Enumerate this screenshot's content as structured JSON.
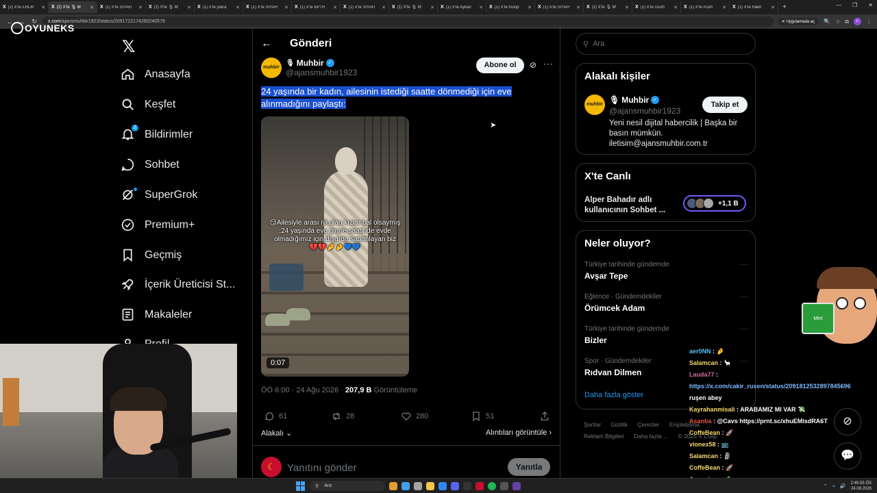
{
  "browser": {
    "tabs": [
      {
        "label": "(2) X'te ERLIK",
        "active": false
      },
      {
        "label": "(2) X'te 🎙 M",
        "active": true
      },
      {
        "label": "(1) X'te SİYAH",
        "active": false
      },
      {
        "label": "(2) X'te 🎙 M",
        "active": false
      },
      {
        "label": "(1) X'te yalca",
        "active": false
      },
      {
        "label": "(1) X'te SİYAH",
        "active": false
      },
      {
        "label": "(1) X'te BPTH",
        "active": false
      },
      {
        "label": "(1) X'te SİYAH",
        "active": false
      },
      {
        "label": "(1) X'te 🎙 M",
        "active": false
      },
      {
        "label": "(1) X'te Aykan",
        "active": false
      },
      {
        "label": "(1) X'te moop",
        "active": false
      },
      {
        "label": "(1) X'te SİYAH",
        "active": false
      },
      {
        "label": "(1) X'te 🎙 M",
        "active": false
      },
      {
        "label": "(1) X'te Gush",
        "active": false
      },
      {
        "label": "(1) X'te Push",
        "active": false
      },
      {
        "label": "(1) X'te Hakh",
        "active": false
      }
    ],
    "url": "x.com/ajansmuhbir1923/status/2091722174260240579",
    "url_domain": "x.com",
    "url_path": "/ajansmuhbir1923/status/2091722174260240579",
    "app_button": "Uygulamada aç"
  },
  "overlay_logo": "OYUNEKS",
  "nav": {
    "items": [
      {
        "label": "Anasayfa",
        "icon": "home-icon"
      },
      {
        "label": "Keşfet",
        "icon": "search-icon"
      },
      {
        "label": "Bildirimler",
        "icon": "bell-icon",
        "badge": "2"
      },
      {
        "label": "Sohbet",
        "icon": "chat-icon"
      },
      {
        "label": "SuperGrok",
        "icon": "grok-icon"
      },
      {
        "label": "Premium+",
        "icon": "verified-icon"
      },
      {
        "label": "Geçmiş",
        "icon": "bookmark-icon"
      },
      {
        "label": "İçerik Üreticisi St...",
        "icon": "rocket-icon"
      },
      {
        "label": "Makaleler",
        "icon": "article-icon"
      },
      {
        "label": "Profil",
        "icon": "profile-icon"
      }
    ]
  },
  "main": {
    "header_title": "Gönderi",
    "author_name": "Muhbir",
    "author_handle": "@ajansmuhbir1923",
    "avatar_text": "muhbir",
    "subscribe_label": "Abone ol",
    "tweet_text_line1": "24 yaşında bir kadın, ailesinin istediği saatte dönmediği için eve",
    "tweet_text_line2": "alınmadığını paylaştı:",
    "video_overlay_line1": "😏Ailesiyle arası iyi olan kızlar bal olsaymış",
    "video_overlay_line2": ":24 yaşında eve girme saatinde evde olmadığımız için dışarda sabahlayan biz",
    "video_overlay_line3": "💔💔🤌🤌💙💙",
    "video_time": "0:07",
    "meta_time": "ÖÖ 6:00 · 24 Ağu 2026 · ",
    "meta_views": "207,9 B",
    "meta_views_label": " Görüntüleme",
    "replies": "61",
    "reposts": "28",
    "likes": "280",
    "bookmarks": "51",
    "relevance_label": "Alakalı",
    "quotes_label": "Alıntıları görüntüle",
    "reply_placeholder": "Yanıtını gönder",
    "reply_button": "Yanıtla"
  },
  "right": {
    "search_placeholder": "Ara",
    "relevant_title": "Alakalı kişiler",
    "person_name": "Muhbir",
    "person_handle": "@ajansmuhbir1923",
    "follow_label": "Takip et",
    "person_bio": "Yeni nesil dijital habercilik | Başka bir basın mümkün. iletisim@ajansmuhbir.com.tr",
    "live_title": "X'te Canlı",
    "live_text": "Alper Bahadır adlı kullanıcının Sohbet ...",
    "live_count": "+1,1 B",
    "trending_title": "Neler oluyor?",
    "trends": [
      {
        "context": "Türkiye tarihinde gündemde",
        "title": "Avşar Tepe"
      },
      {
        "context": "Eğlence · Gündemdekiler",
        "title": "Örümcek Adam"
      },
      {
        "context": "Türkiye tarihinde gündemde",
        "title": "Bizler"
      },
      {
        "context": "Spor · Gündemdekiler",
        "title": "Rıdvan Dilmen"
      }
    ],
    "show_more": "Daha fazla göster",
    "footer_line1": [
      "Şartlar",
      "Gizlilik",
      "Çerezler",
      "Erişilebilirlik"
    ],
    "footer_line2": [
      "Reklam Bilgileri",
      "Daha fazla ...",
      "© 2026 X Corp."
    ]
  },
  "chat": [
    {
      "user": "aer0NN",
      "color": "#4fc3f7",
      "msg": " : 🤌"
    },
    {
      "user": "Salamcan",
      "color": "#f5d76e",
      "msg": " : 🦙"
    },
    {
      "user": "Lauda77",
      "color": "#d16ba5",
      "msg": " :"
    },
    {
      "user": "",
      "color": "#fff",
      "msg": "https://x.com/cakir_rusen/status/2091812532897845696",
      "link": true
    },
    {
      "user": "",
      "color": "#fff",
      "msg": "ruşen abey"
    },
    {
      "user": "Kayrahanmisali",
      "color": "#f5d76e",
      "msg": " : ARABAMIZ MI VAR 💸"
    },
    {
      "user": "Asanba",
      "color": "#e5533d",
      "msg": " : @Cavs https://prnt.sc/xhuEMisdRA6T"
    },
    {
      "user": "CoffeBean",
      "color": "#f5d76e",
      "msg": " : 🚀"
    },
    {
      "user": "vionex58",
      "color": "#f5d76e",
      "msg": " : 📺"
    },
    {
      "user": "Salamcan",
      "color": "#f5d76e",
      "msg": " : 🗿"
    },
    {
      "user": "CoffeBean",
      "color": "#f5d76e",
      "msg": " : 🚀"
    },
    {
      "user": "Acequinn",
      "color": "#f5d76e",
      "msg": " : 🥒"
    }
  ],
  "mascot_can_label": "Mint",
  "taskbar": {
    "search_label": "Ara",
    "time": "2:45:55 ÖS",
    "date": "24.08.2026"
  },
  "colors": {
    "accent": "#1d9bf0",
    "background": "#000000",
    "text": "#e7e9ea",
    "muted": "#71767b",
    "border": "#2f3336",
    "selection": "#1a4fd1"
  }
}
